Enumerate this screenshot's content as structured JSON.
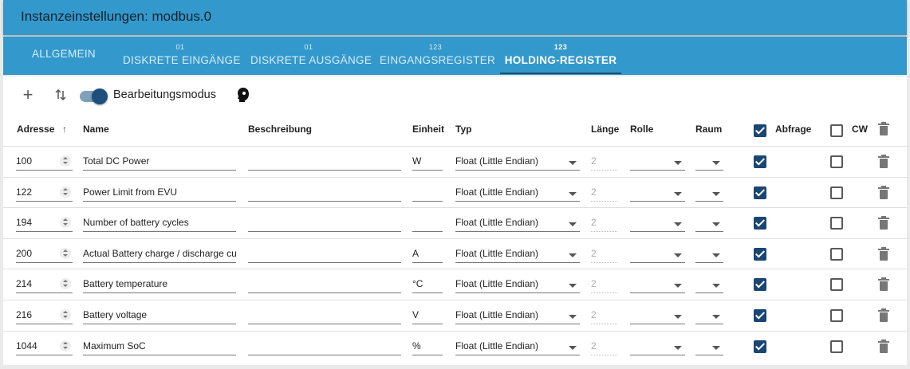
{
  "window": {
    "title": "Instanzeinstellungen: modbus.0"
  },
  "tabs": [
    {
      "icon": "",
      "label": "ALLGEMEIN"
    },
    {
      "icon": "01",
      "label": "DISKRETE EINGÄNGE"
    },
    {
      "icon": "01",
      "label": "DISKRETE AUSGÄNGE"
    },
    {
      "icon": "123",
      "label": "EINGANGSREGISTER"
    },
    {
      "icon": "123",
      "label": "HOLDING-REGISTER"
    }
  ],
  "active_tab": "HOLDING-REGISTER",
  "toolbar": {
    "add_icon": "plus-icon",
    "sort_icon": "sort-arrows-icon",
    "toggle_label": "Bearbeitungsmodus",
    "toggle_on": true,
    "extra_icon": "head-icon"
  },
  "columns": {
    "adresse": "Adresse",
    "name": "Name",
    "beschreibung": "Beschreibung",
    "einheit": "Einheit",
    "typ": "Typ",
    "laenge": "Länge",
    "rolle": "Rolle",
    "raum": "Raum",
    "abfrage": "Abfrage",
    "cw": "CW"
  },
  "header_checks": {
    "abfrage": true,
    "cw": false
  },
  "rows": [
    {
      "adresse": "100",
      "name": "Total DC Power",
      "beschreibung": "",
      "einheit": "W",
      "typ": "Float (Little Endian)",
      "laenge": "2",
      "rolle": "",
      "raum": "",
      "abfrage": true,
      "cw": false
    },
    {
      "adresse": "122",
      "name": "Power Limit from EVU",
      "beschreibung": "",
      "einheit": "",
      "typ": "Float (Little Endian)",
      "laenge": "2",
      "rolle": "",
      "raum": "",
      "abfrage": true,
      "cw": false
    },
    {
      "adresse": "194",
      "name": "Number of battery cycles",
      "beschreibung": "",
      "einheit": "",
      "typ": "Float (Little Endian)",
      "laenge": "2",
      "rolle": "",
      "raum": "",
      "abfrage": true,
      "cw": false
    },
    {
      "adresse": "200",
      "name": "Actual Battery charge / discharge cur",
      "beschreibung": "",
      "einheit": "A",
      "typ": "Float (Little Endian)",
      "laenge": "2",
      "rolle": "",
      "raum": "",
      "abfrage": true,
      "cw": false
    },
    {
      "adresse": "214",
      "name": "Battery temperature",
      "beschreibung": "",
      "einheit": "°C",
      "typ": "Float (Little Endian)",
      "laenge": "2",
      "rolle": "",
      "raum": "",
      "abfrage": true,
      "cw": false
    },
    {
      "adresse": "216",
      "name": "Battery voltage",
      "beschreibung": "",
      "einheit": "V",
      "typ": "Float (Little Endian)",
      "laenge": "2",
      "rolle": "",
      "raum": "",
      "abfrage": true,
      "cw": false
    },
    {
      "adresse": "1044",
      "name": "Maximum SoC",
      "beschreibung": "",
      "einheit": "%",
      "typ": "Float (Little Endian)",
      "laenge": "2",
      "rolle": "",
      "raum": "",
      "abfrage": true,
      "cw": false
    }
  ],
  "colors": {
    "header_blue": "#3399cc",
    "check_blue": "#1a4673",
    "toggle_knob": "#1e4f7d"
  }
}
